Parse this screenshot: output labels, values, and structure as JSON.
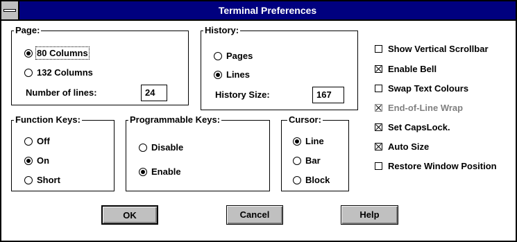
{
  "window": {
    "title": "Terminal Preferences"
  },
  "page_group": {
    "label": "Page:",
    "options": [
      {
        "label": "80 Columns",
        "selected": true
      },
      {
        "label": "132 Columns",
        "selected": false
      }
    ],
    "lines_label": "Number of lines:",
    "lines_value": "24"
  },
  "history_group": {
    "label": "History:",
    "options": [
      {
        "label": "Pages",
        "selected": false
      },
      {
        "label": "Lines",
        "selected": true
      }
    ],
    "size_label": "History Size:",
    "size_value": "167"
  },
  "function_keys_group": {
    "label": "Function Keys:",
    "options": [
      {
        "label": "Off",
        "selected": false
      },
      {
        "label": "On",
        "selected": true
      },
      {
        "label": "Short",
        "selected": false
      }
    ]
  },
  "programmable_keys_group": {
    "label": "Programmable Keys:",
    "options": [
      {
        "label": "Disable",
        "selected": false
      },
      {
        "label": "Enable",
        "selected": true
      }
    ]
  },
  "cursor_group": {
    "label": "Cursor:",
    "options": [
      {
        "label": "Line",
        "selected": true
      },
      {
        "label": "Bar",
        "selected": false
      },
      {
        "label": "Block",
        "selected": false
      }
    ]
  },
  "checkboxes": [
    {
      "label": "Show Vertical Scrollbar",
      "checked": false,
      "enabled": true
    },
    {
      "label": "Enable Bell",
      "checked": true,
      "enabled": true
    },
    {
      "label": "Swap Text Colours",
      "checked": false,
      "enabled": true
    },
    {
      "label": "End-of-Line Wrap",
      "checked": true,
      "enabled": false
    },
    {
      "label": "Set CapsLock.",
      "checked": true,
      "enabled": true
    },
    {
      "label": "Auto Size",
      "checked": true,
      "enabled": true
    },
    {
      "label": "Restore Window Position",
      "checked": false,
      "enabled": true
    }
  ],
  "buttons": {
    "ok": "OK",
    "cancel": "Cancel",
    "help": "Help"
  }
}
